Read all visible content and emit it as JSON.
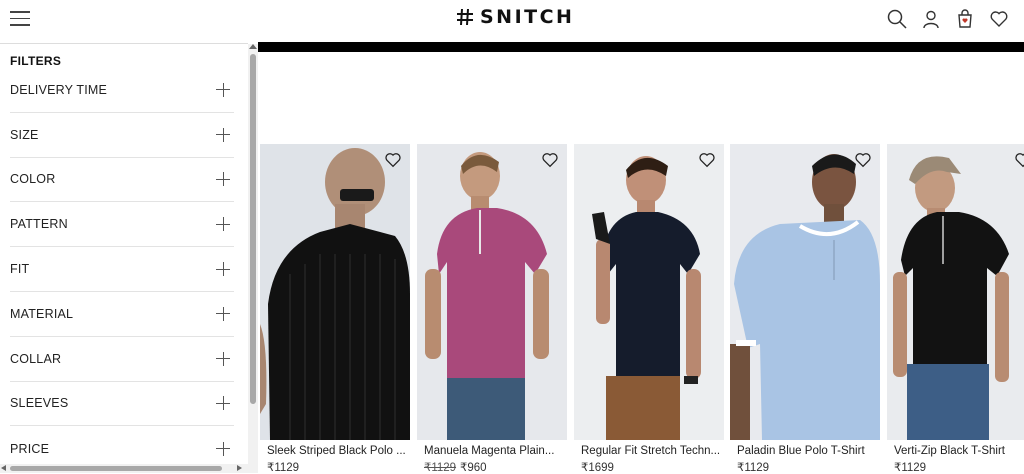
{
  "brand": {
    "name": "SNITCH"
  },
  "header_icons": [
    "search-icon",
    "user-icon",
    "cart-icon",
    "wishlist-icon"
  ],
  "filters": {
    "title": "FILTERS",
    "items": [
      {
        "label": "DELIVERY TIME"
      },
      {
        "label": "SIZE"
      },
      {
        "label": "COLOR"
      },
      {
        "label": "PATTERN"
      },
      {
        "label": "FIT"
      },
      {
        "label": "MATERIAL"
      },
      {
        "label": "COLLAR"
      },
      {
        "label": "SLEEVES"
      },
      {
        "label": "PRICE"
      }
    ]
  },
  "products": [
    {
      "name": "Sleek Striped Black Polo ...",
      "price": "₹1129",
      "old_price": ""
    },
    {
      "name": "Manuela Magenta Plain...",
      "price": "₹960",
      "old_price": "₹1129"
    },
    {
      "name": "Regular Fit Stretch Techn...",
      "price": "₹1699",
      "old_price": ""
    },
    {
      "name": "Paladin Blue Polo T-Shirt",
      "price": "₹1129",
      "old_price": ""
    },
    {
      "name": "Verti-Zip Black T-Shirt",
      "price": "₹1129",
      "old_price": ""
    }
  ],
  "colors": {
    "banner": "#000000",
    "text": "#222222",
    "divider": "#e3e3e3"
  }
}
